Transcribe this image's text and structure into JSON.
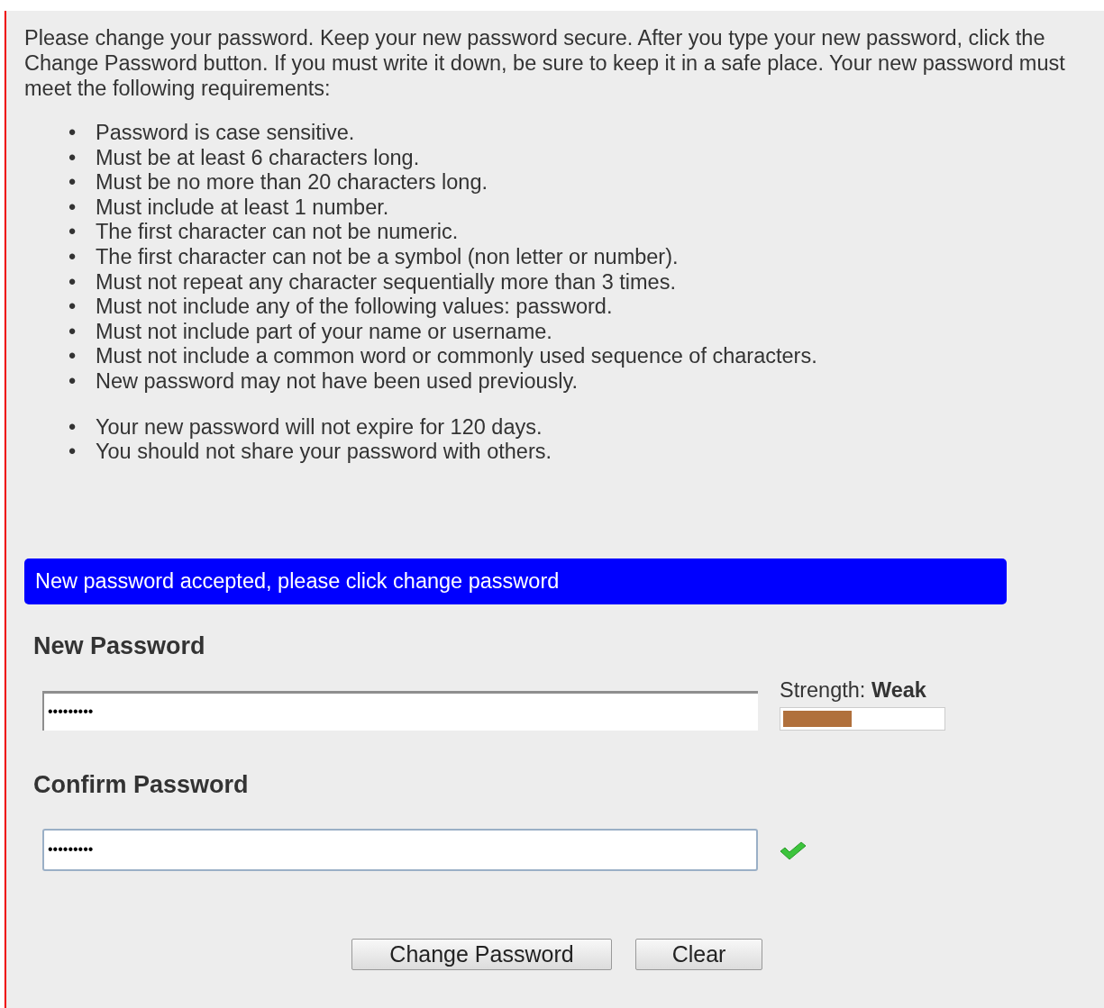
{
  "intro": "Please change your password. Keep your new password secure. After you type your new password, click the Change Password button. If you must write it down, be sure to keep it in a safe place. Your new password must meet the following requirements:",
  "requirements": [
    {
      "marker": "•",
      "text": "Password is case sensitive."
    },
    {
      "marker": "•",
      "text": "Must be at least 6 characters long."
    },
    {
      "marker": "•",
      "text": "Must be no more than 20 characters long."
    },
    {
      "marker": "•",
      "text": "Must include at least 1 number."
    },
    {
      "marker": "•",
      "text": "The first character can not be numeric."
    },
    {
      "marker": "•",
      "text": "The first character can not be a symbol (non letter or number)."
    },
    {
      "marker": "•",
      "text": "Must not repeat any character sequentially more than 3 times."
    },
    {
      "marker": "•",
      "text": "Must not include any of the following values: password."
    },
    {
      "marker": "•",
      "text": "Must not include part of your name or username."
    },
    {
      "marker": "•",
      "text": "Must not include a common word or commonly used sequence of characters."
    },
    {
      "marker": "•",
      "text": "New password may not have been used previously."
    }
  ],
  "notes": [
    {
      "marker": "•",
      "text": "Your new password will not expire for 120 days."
    },
    {
      "marker": "•",
      "text": "You should not share your password with others."
    }
  ],
  "message": "New password accepted, please click change password",
  "new_password": {
    "label": "New Password",
    "value": "•••••••••",
    "focused": false
  },
  "strength": {
    "label": "Strength:",
    "value": "Weak",
    "level": 0.43
  },
  "confirm_password": {
    "label": "Confirm Password",
    "value": "•••••••••",
    "focused": true,
    "valid": true
  },
  "buttons": [
    "Change Password",
    "Clear"
  ]
}
